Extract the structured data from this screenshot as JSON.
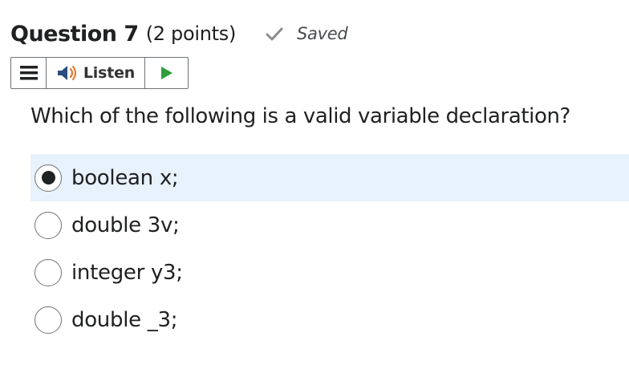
{
  "question": {
    "title": "Question 7",
    "points": "(2 points)",
    "status": "Saved",
    "prompt": "Which of the following is a valid variable declaration?",
    "selected_index": 0,
    "options": [
      {
        "label": "boolean x;"
      },
      {
        "label": "double 3v;"
      },
      {
        "label": "integer y3;"
      },
      {
        "label": "double _3;"
      }
    ]
  },
  "toolbar": {
    "listen_label": "Listen",
    "icons": [
      "menu-icon",
      "speaker-icon",
      "play-icon"
    ]
  },
  "colors": {
    "selected_row_bg": "#e8f2fc",
    "play_green": "#2e9e3b",
    "speaker_blue": "#2a4f7e",
    "speaker_wave_orange": "#e6762b",
    "text": "#202122"
  }
}
